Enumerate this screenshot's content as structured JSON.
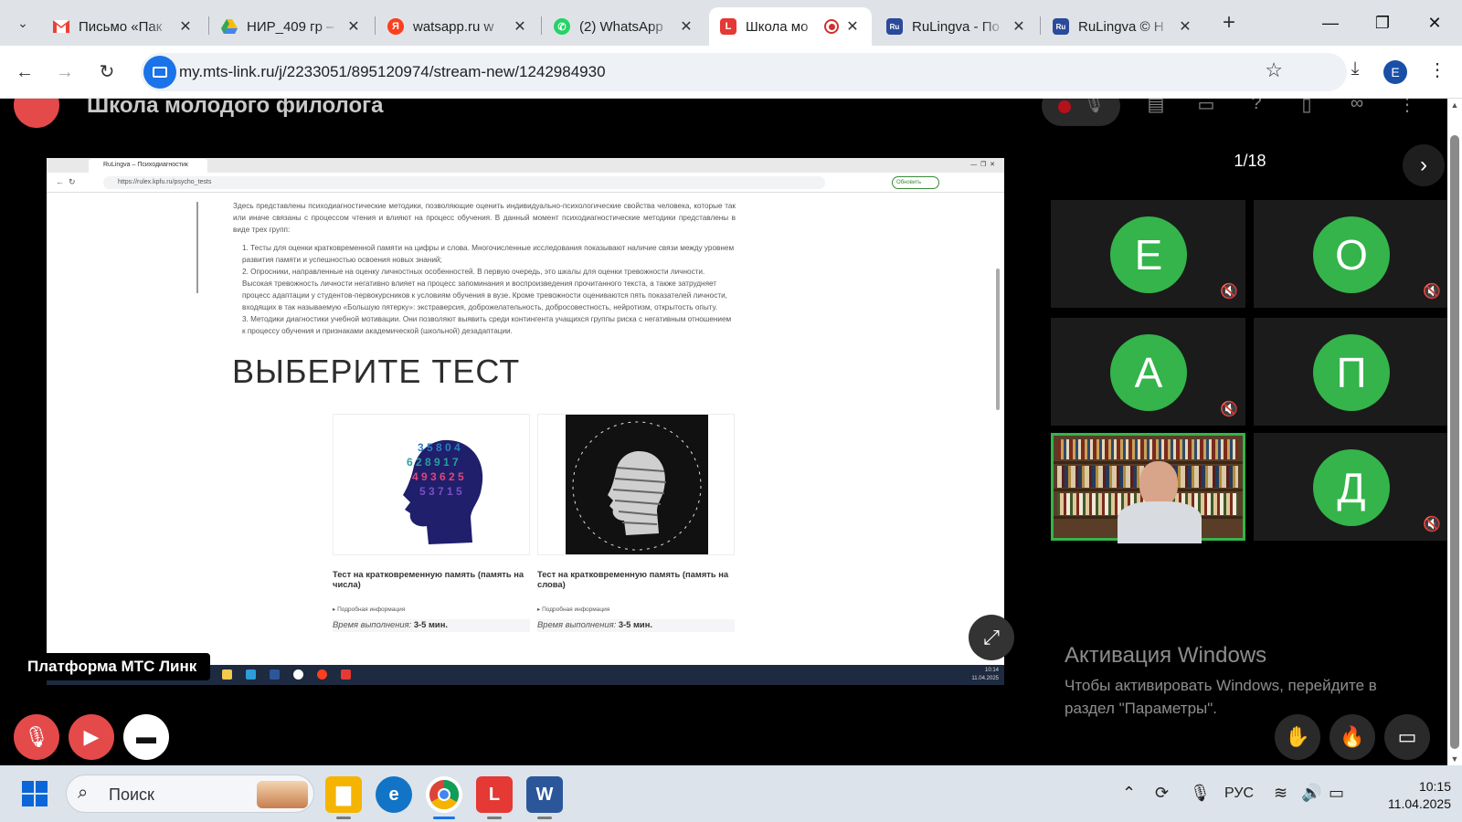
{
  "browser": {
    "tabs": [
      {
        "title": "Письмо «Пак",
        "favicon": "gmail-icon",
        "color": "#ea4335",
        "active": false
      },
      {
        "title": "НИР_409 гр –",
        "favicon": "drive-icon",
        "color": "#34a853",
        "active": false
      },
      {
        "title": "watsapp.ru w",
        "favicon": "yandex-icon",
        "color": "#fc3f1d",
        "active": false
      },
      {
        "title": "(2) WhatsApp",
        "favicon": "whatsapp-icon",
        "color": "#25d366",
        "active": false
      },
      {
        "title": "Школа мо",
        "favicon": "mts-link-icon",
        "color": "#e53935",
        "active": true
      },
      {
        "title": "RuLingva - По",
        "favicon": "rulingva-icon",
        "color": "#2b4a9b",
        "active": false
      },
      {
        "title": "RuLingva © Н",
        "favicon": "rulingva-icon",
        "color": "#2b4a9b",
        "active": false
      }
    ],
    "url": "my.mts-link.ru/j/2233051/895120974/stream-new/1242984930",
    "profile_initial": "E"
  },
  "room": {
    "title": "Школа молодого филолога",
    "pager": "1/18",
    "platform_tag": "Платформа МТС Линк"
  },
  "shared_screen": {
    "tab_title": "RuLingva – Психодиагностик",
    "url": "https://rulex.kpfu.ru/psycho_tests",
    "update_label": "Обновить",
    "intro": "Здесь представлены психодиагностические методики, позволяющие оценить индивидуально-психологические свойства человека, которые так или иначе связаны с процессом чтения и влияют на процесс обучения. В данный момент психодиагностические методики представлены в виде трех групп:",
    "list": [
      "1. Тесты для оценки кратковременной памяти на цифры и слова. Многочисленные исследования показывают наличие связи между уровнем развития памяти и успешностью освоения новых знаний;",
      "2. Опросники, направленные на оценку личностных особенностей. В первую очередь, это шкалы для оценки тревожности личности. Высокая тревожность личности негативно влияет на процесс запоминания и воспроизведения прочитанного текста, а также затрудняет процесс адаптации у студентов-первокурсников к условиям обучения в вузе. Кроме тревожности оцениваются пять показателей личности, входящих в так называемую «Большую пятерку»: экстраверсия, доброжелательность, добросовестность, нейротизм, открытость опыту.",
      "3. Методики диагностики учебной мотивации. Они позволяют выявить среди контингента учащихся группы риска с негативным отношением к процессу обучения и признаками академической (школьной) дезадаптации."
    ],
    "heading": "ВЫБЕРИТЕ ТЕСТ",
    "cards": [
      {
        "caption": "Тест на кратковременную память (память на числа)",
        "more": "▸ Подробная информация",
        "time_label": "Время выполнения:",
        "time_value": "3-5 мин."
      },
      {
        "caption": "Тест на кратковременную память (память на слова)",
        "more": "▸ Подробная информация",
        "time_label": "Время выполнения:",
        "time_value": "3-5 мин."
      }
    ],
    "clock_time": "10:14",
    "clock_date": "11.04.2025"
  },
  "participants": [
    {
      "initial": "Е",
      "muted": true
    },
    {
      "initial": "О",
      "muted": true
    },
    {
      "initial": "А",
      "muted": true
    },
    {
      "initial": "П",
      "muted": false
    },
    {
      "initial": "",
      "muted": false,
      "speaker": true
    },
    {
      "initial": "Д",
      "muted": true
    }
  ],
  "windows_activation": {
    "title": "Активация Windows",
    "text": "Чтобы активировать Windows, перейдите в раздел \"Параметры\"."
  },
  "taskbar": {
    "search_placeholder": "Поиск",
    "language": "РУС",
    "time": "10:15",
    "date": "11.04.2025"
  }
}
